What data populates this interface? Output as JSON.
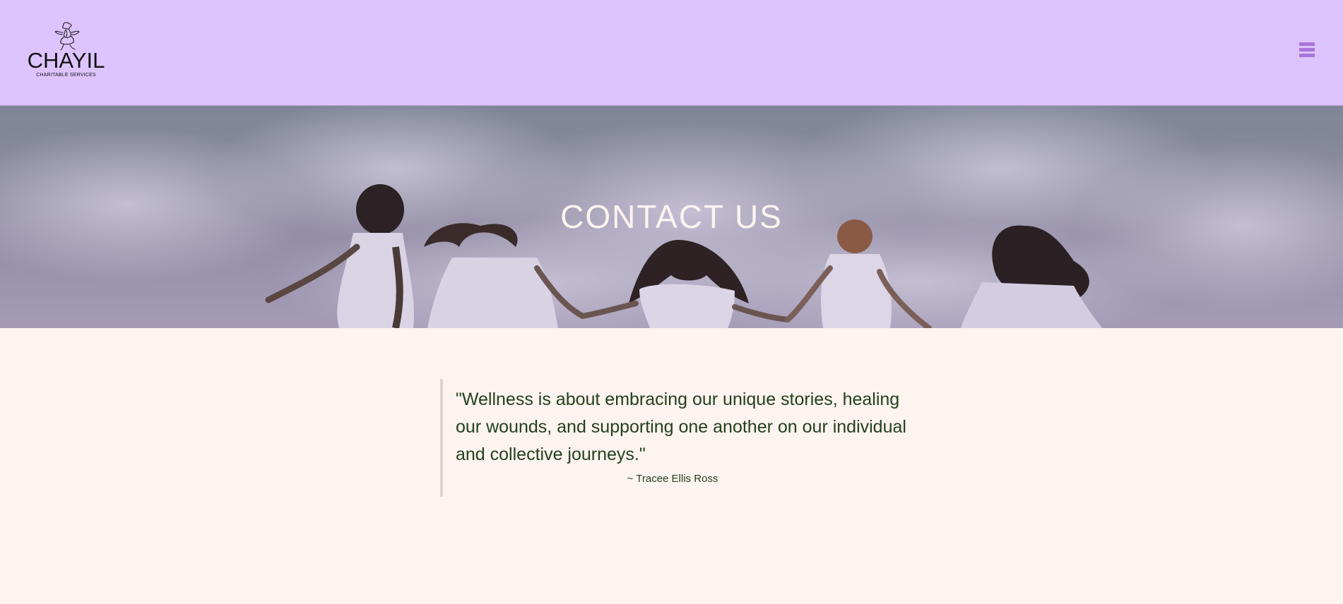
{
  "header": {
    "logo": {
      "name": "CHAYIL",
      "tagline": "CHARITABLE SERVICES",
      "icon": "woman-figure-logo-icon"
    },
    "menu_icon": "hamburger-menu-icon",
    "colors": {
      "background": "#dec4ff",
      "menu_icon": "#a875d9"
    }
  },
  "hero": {
    "title": "CONTACT US",
    "image": "women-running-under-cloudy-sky"
  },
  "quote": {
    "text": "\"Wellness is about embracing our unique stories, healing our wounds, and supporting one another on our individual and collective journeys.\"",
    "author": "~ Tracee Ellis Ross"
  },
  "colors": {
    "page_background": "#fdf3ef",
    "quote_text": "#23401f",
    "hero_title": "#fbf4f0"
  }
}
